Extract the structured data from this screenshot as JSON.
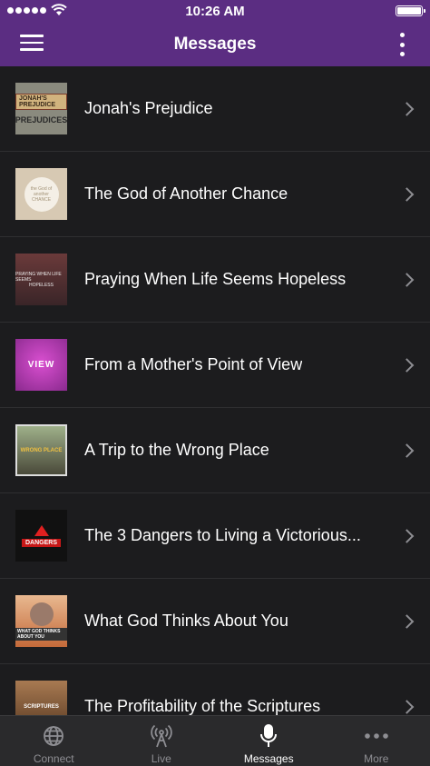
{
  "status_bar": {
    "time": "10:26 AM"
  },
  "header": {
    "title": "Messages"
  },
  "messages": [
    {
      "title": "Jonah's Prejudice",
      "thumb_line1": "JONAH'S PREJUDICE",
      "thumb_line2": "PREJUDICES"
    },
    {
      "title": "The God of Another Chance",
      "thumb_line1": "the God of another CHANCE"
    },
    {
      "title": "Praying When Life Seems Hopeless",
      "thumb_line1": "PRAYING WHEN LIFE SEEMS",
      "thumb_line2": "HOPELESS"
    },
    {
      "title": "From a Mother's Point of View",
      "thumb_line1": "VIEW"
    },
    {
      "title": "A Trip to the Wrong Place",
      "thumb_line1": "WRONG PLACE"
    },
    {
      "title": "The 3 Dangers to Living a Victorious...",
      "thumb_line1": "DANGERS"
    },
    {
      "title": "What God Thinks About You",
      "thumb_line1": "WHAT GOD THINKS ABOUT YOU"
    },
    {
      "title": "The Profitability of the Scriptures",
      "thumb_line1": "SCRIPTURES"
    }
  ],
  "tabs": [
    {
      "label": "Connect",
      "icon": "globe-icon"
    },
    {
      "label": "Live",
      "icon": "broadcast-icon"
    },
    {
      "label": "Messages",
      "icon": "microphone-icon"
    },
    {
      "label": "More",
      "icon": "ellipsis-icon"
    }
  ],
  "colors": {
    "header": "#5b2d82",
    "list_bg": "#1c1c1e",
    "tab_bar": "#2a2a2c"
  }
}
